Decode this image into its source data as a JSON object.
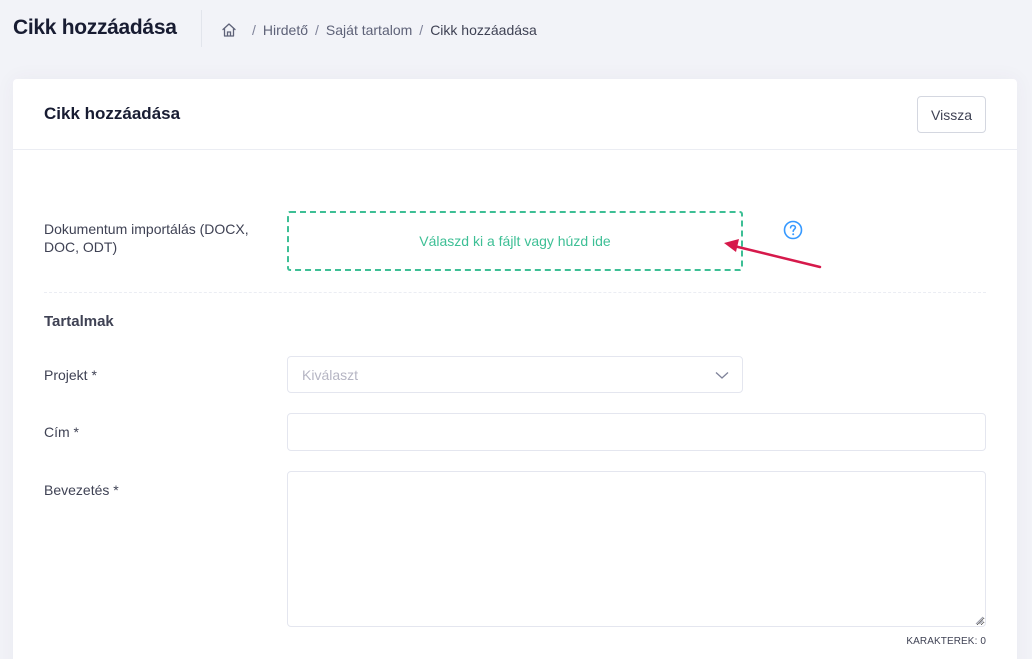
{
  "header": {
    "title": "Cikk hozzáadása",
    "breadcrumb": [
      "Hirdető",
      "Saját tartalom",
      "Cikk hozzáadása"
    ],
    "separator": "/"
  },
  "card": {
    "title": "Cikk hozzáadása",
    "back_label": "Vissza"
  },
  "import": {
    "label": "Dokumentum importálás (DOCX, DOC, ODT)",
    "dropzone_text": "Válaszd ki a fájlt vagy húzd ide",
    "help_icon": "question-circle-icon"
  },
  "section": {
    "title": "Tartalmak"
  },
  "fields": {
    "projekt": {
      "label": "Projekt *",
      "placeholder": "Kiválaszt"
    },
    "cim": {
      "label": "Cím *",
      "value": ""
    },
    "bevezetes": {
      "label": "Bevezetés *",
      "value": "",
      "char_count": "KARAKTEREK: 0"
    }
  },
  "colors": {
    "accent_green": "#3dbf95",
    "help_blue": "#3699ff",
    "arrow_red": "#d6194b"
  }
}
